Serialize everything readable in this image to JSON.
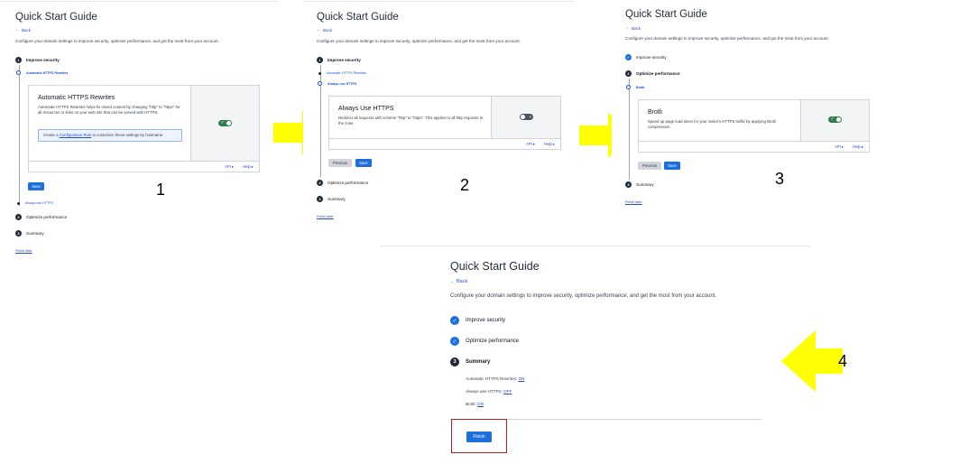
{
  "guide": {
    "title": "Quick Start Guide",
    "back": "Back",
    "description": "Configure your domain settings to improve security, optimize performance, and get the most from your account.",
    "finish_later": "Finish later"
  },
  "steps": {
    "improve_security": "Improve security",
    "optimize_performance": "Optimize performance",
    "summary": "Summary",
    "num1": "1",
    "num2": "2",
    "num3": "3"
  },
  "substeps": {
    "automatic_https": "Automatic HTTPS Rewrites",
    "always_https": "Always use HTTPS",
    "brotli": "Brotli"
  },
  "cards": {
    "automatic_https": {
      "title": "Automatic HTTPS Rewrites",
      "description": "Automatic HTTPS Rewrites helps fix mixed content by changing \"http\" to \"https\" for all resources or links on your web site that can be served with HTTPS.",
      "note_prefix": "Create a ",
      "note_link": "Configuration Rule",
      "note_suffix": " to customize these settings by hostname.",
      "toggle_state": "on"
    },
    "always_https": {
      "title": "Always Use HTTPS",
      "description": "Redirect all requests with scheme \"http\" to \"https\". This applies to all http requests to the zone.",
      "toggle_state": "off"
    },
    "brotli": {
      "title": "Brotli",
      "description": "Speed up page load times for your visitor's HTTPS traffic by applying Brotli compression.",
      "toggle_state": "on"
    },
    "api": "API",
    "help": "Help"
  },
  "buttons": {
    "save": "Save",
    "previous": "Previous",
    "finish": "Finish"
  },
  "summary": {
    "automatic_https_label": "Automatic HTTPS Rewrites: ",
    "automatic_https_value": "ON",
    "always_https_label": "Always use HTTPS: ",
    "always_https_value": "OFF",
    "brotli_label": "Brotli: ",
    "brotli_value": "ON"
  },
  "markers": {
    "m1": "1",
    "m2": "2",
    "m3": "3",
    "m4": "4"
  },
  "colors": {
    "accent": "#1d6fdc",
    "arrow": "#ffff00",
    "toggle_on": "#2f7d4b",
    "highlight": "#b91c1c"
  }
}
